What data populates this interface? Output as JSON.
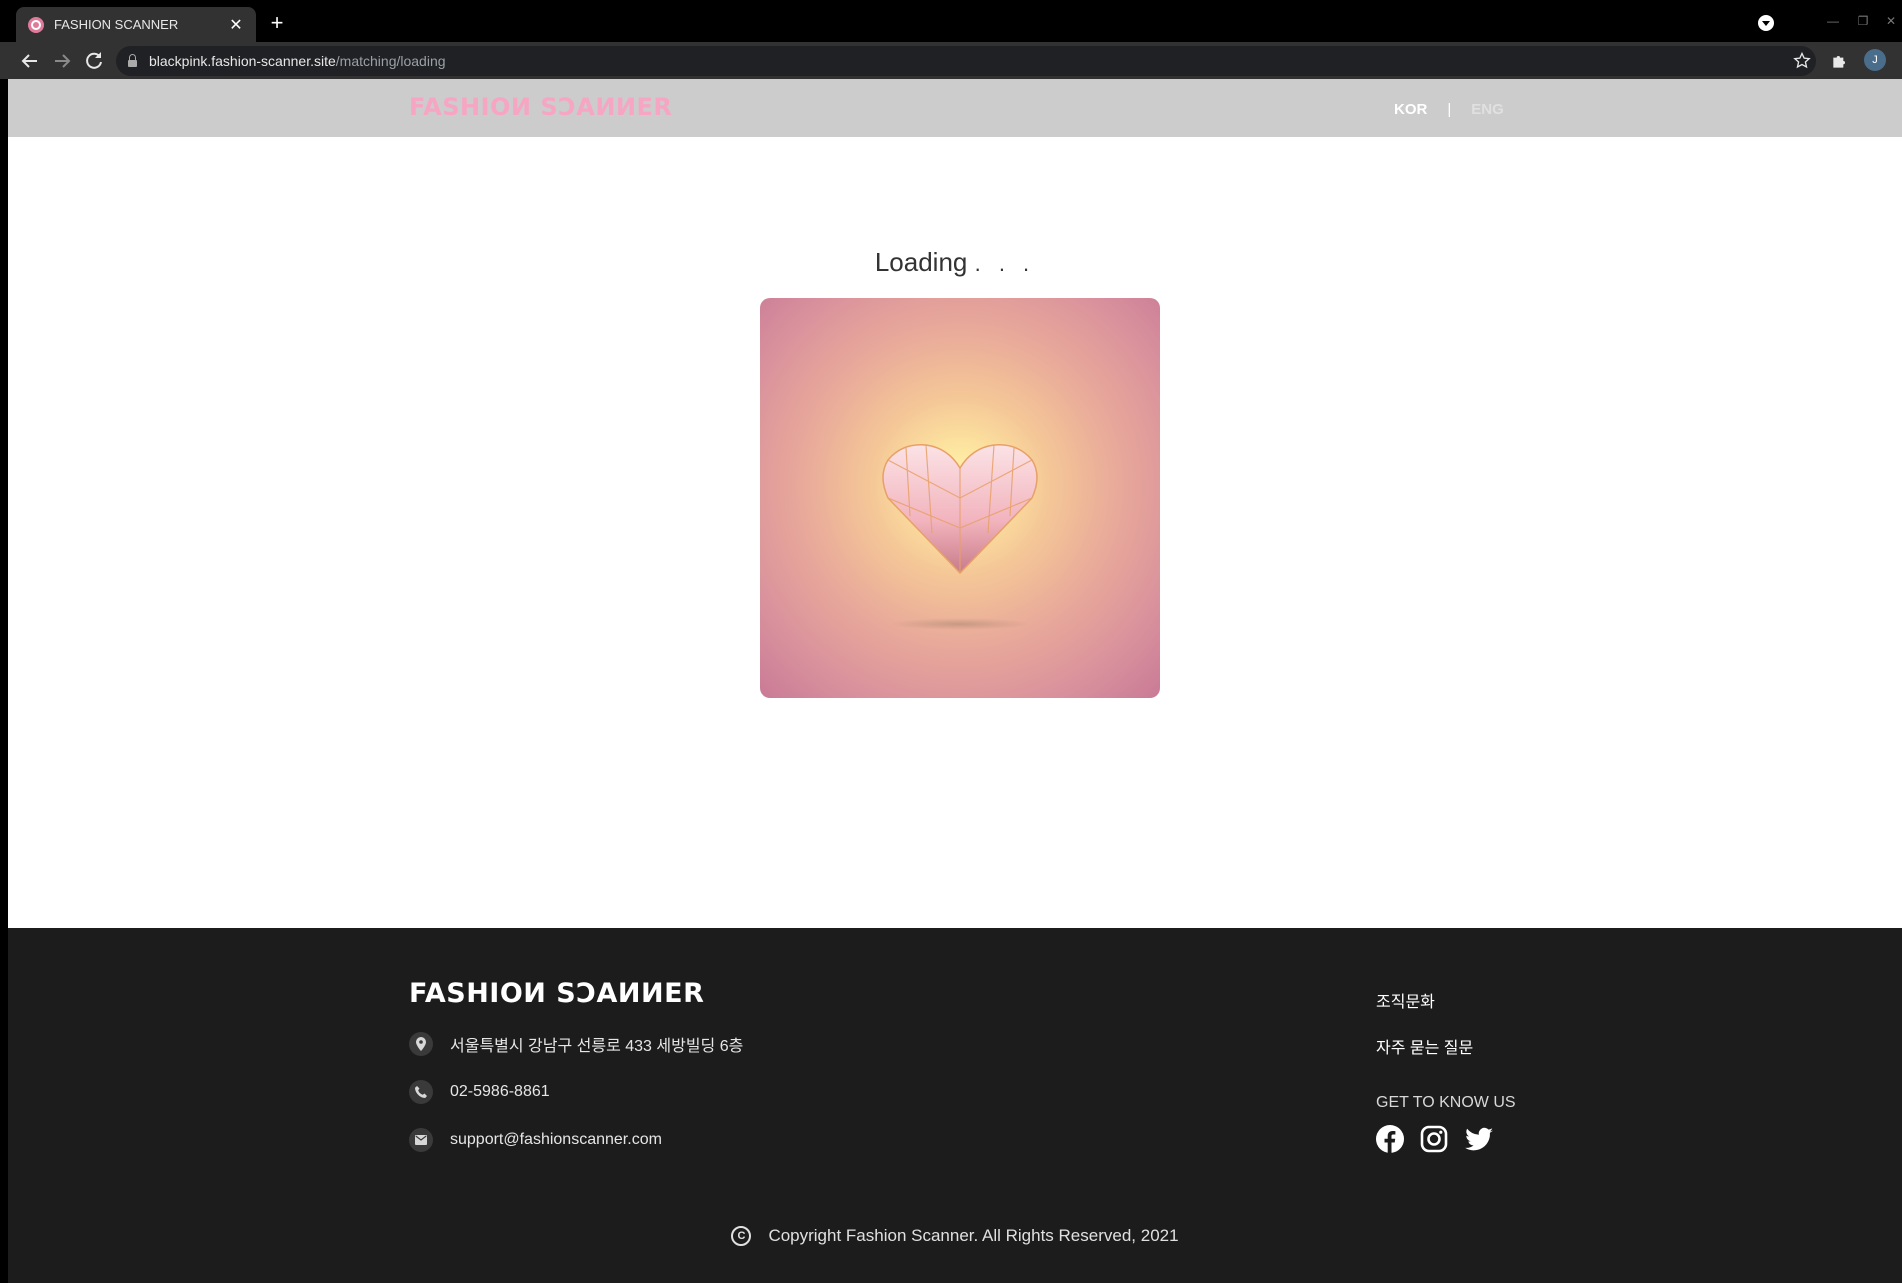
{
  "browser": {
    "tab_title": "FASHION SCANNER",
    "tab_close": "✕",
    "new_tab": "+",
    "url_host": "blackpink.fashion-scanner.site",
    "url_path": "/matching/loading",
    "avatar_letter": "J",
    "minimize": "—",
    "restore": "❐",
    "close": "✕"
  },
  "header": {
    "logo": "FASHIOИ SƆAИИER",
    "lang_kor": "KOR",
    "lang_sep": "|",
    "lang_eng": "ENG"
  },
  "main": {
    "loading_text": "Loading",
    "loading_dots": ". . ."
  },
  "footer": {
    "logo": "FASHIOИ SƆAИИER",
    "address": "서울특별시 강남구 선릉로 433 세방빌딩 6층",
    "phone": "02-5986-8861",
    "email": "support@fashionscanner.com",
    "links": [
      "조직문화",
      "자주 묻는 질문"
    ],
    "get_to_know": "GET TO KNOW US",
    "social_icons": [
      "facebook-icon",
      "instagram-icon",
      "twitter-icon"
    ],
    "copyright": "Copyright Fashion Scanner. All Rights Reserved, 2021",
    "copyright_symbol": "C"
  },
  "colors": {
    "logo_pink": "#f6a6c3",
    "header_bg": "#cccccc",
    "footer_bg": "#1c1c1c"
  }
}
